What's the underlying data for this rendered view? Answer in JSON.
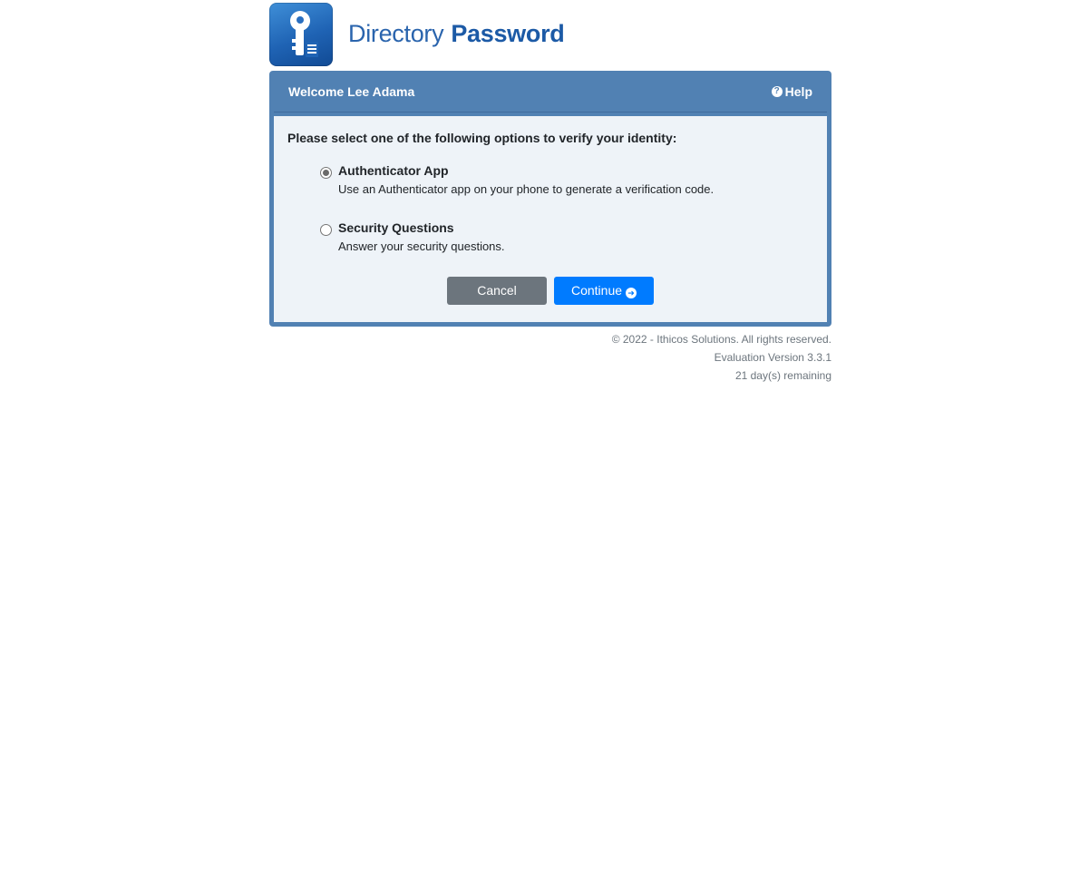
{
  "brand": {
    "logo_icon": "key-document-icon",
    "word1": "Directory",
    "word2": "Password"
  },
  "header": {
    "welcome": "Welcome Lee Adama",
    "help_label": "Help",
    "help_icon": "question-circle-icon"
  },
  "body": {
    "prompt": "Please select one of the following options to verify your identity:",
    "options": [
      {
        "title": "Authenticator App",
        "description": "Use an Authenticator app on your phone to generate a verification code.",
        "selected": true
      },
      {
        "title": "Security Questions",
        "description": "Answer your security questions.",
        "selected": false
      }
    ],
    "cancel_label": "Cancel",
    "continue_label": "Continue",
    "continue_icon": "arrow-circle-right-icon"
  },
  "footer": {
    "copyright": "© 2022 - Ithicos Solutions. All rights reserved.",
    "version": "Evaluation Version 3.3.1",
    "remaining": "21 day(s) remaining"
  },
  "colors": {
    "header_bg": "#5181b3",
    "body_bg": "#eef3f8",
    "cancel_bg": "#6c757d",
    "continue_bg": "#007bff",
    "brand_blue": "#1c5aa6"
  }
}
